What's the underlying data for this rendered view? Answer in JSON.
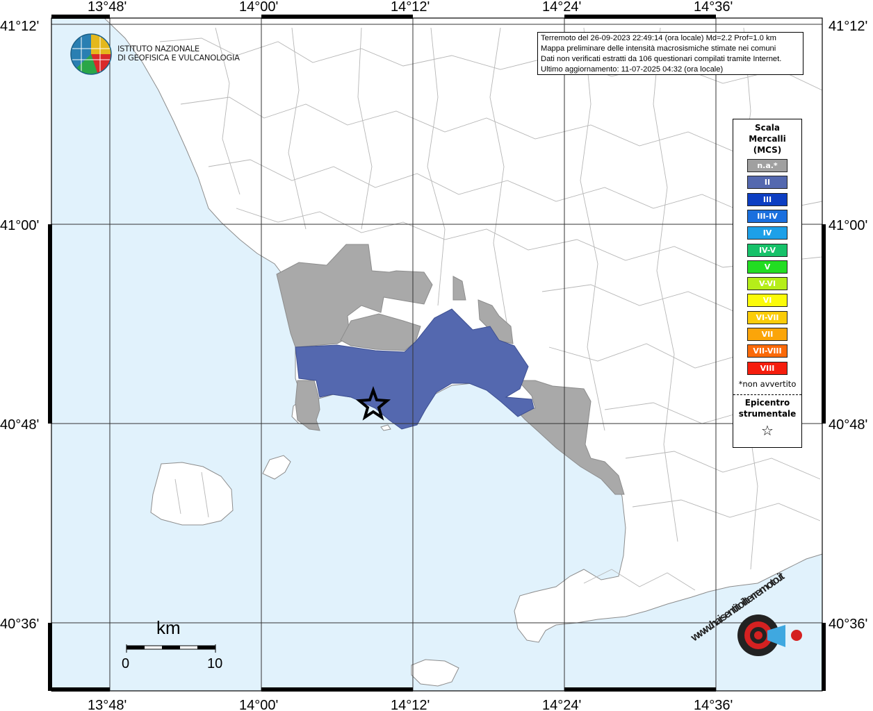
{
  "map": {
    "lat_ticks": [
      "41°12'",
      "41°00'",
      "40°48'",
      "40°36'"
    ],
    "lon_ticks": [
      "13°48'",
      "14°00'",
      "14°12'",
      "14°24'",
      "14°36'"
    ],
    "colors": {
      "sea": "#e1f2fc",
      "land": "#ffffff",
      "not_felt": "#a9a9a9",
      "intensity_II": "#5468af"
    }
  },
  "info": {
    "line1": "Terremoto del 26-09-2023 22:49:14 (ora locale) Md=2.2 Prof=1.0 km",
    "line2": "Mappa preliminare delle intensità macrosismiche stimate nei comuni",
    "line3": "Dati non verificati estratti da 106 questionari compilati tramite Internet.",
    "line4": "Ultimo aggiornamento: 11-07-2025 04:32 (ora locale)"
  },
  "logo": {
    "line1": "ISTITUTO NAZIONALE",
    "line2": "DI GEOFISICA E VULCANOLOGIA",
    "icon": "ingv-globe-icon"
  },
  "legend": {
    "title1": "Scala",
    "title2": "Mercalli",
    "title3": "(MCS)",
    "items": [
      {
        "label": "n.a.*",
        "color": "#a0a0a0"
      },
      {
        "label": "II",
        "color": "#5468af"
      },
      {
        "label": "III",
        "color": "#0d3ec2"
      },
      {
        "label": "III-IV",
        "color": "#1a6fde"
      },
      {
        "label": "IV",
        "color": "#1da0e8"
      },
      {
        "label": "IV-V",
        "color": "#16c26a"
      },
      {
        "label": "V",
        "color": "#22dd22"
      },
      {
        "label": "V-VI",
        "color": "#b5ee19"
      },
      {
        "label": "VI",
        "color": "#fbfb09"
      },
      {
        "label": "VI-VII",
        "color": "#fbcc09"
      },
      {
        "label": "VII",
        "color": "#fba509"
      },
      {
        "label": "VII-VIII",
        "color": "#fb6a09"
      },
      {
        "label": "VIII",
        "color": "#f51d0d"
      }
    ],
    "note": "*non avvertito",
    "epicentre1": "Epicentro",
    "epicentre2": "strumentale",
    "epicentre_symbol": "☆"
  },
  "scale_bar": {
    "unit": "km",
    "start": "0",
    "end": "10"
  },
  "badge": {
    "text": "www.haisentitoilterremoto.it",
    "icon": "target-speaker-icon"
  }
}
